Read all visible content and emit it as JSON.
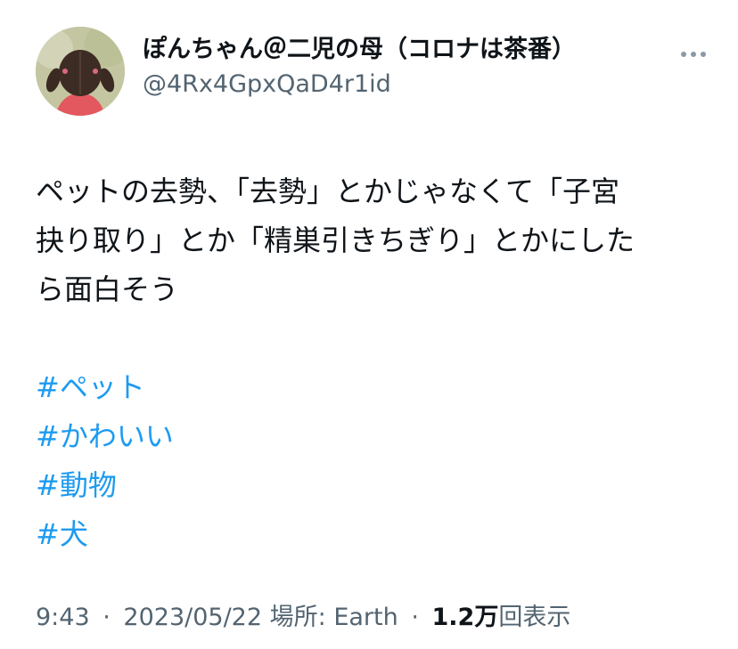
{
  "author": {
    "display_name": "ぽんちゃん＠二児の母（コロナは茶番）",
    "handle": "@4Rx4GpxQaD4r1id"
  },
  "tweet": {
    "lines": [
      "ペットの去勢、「去勢」とかじゃなくて「子宮",
      "抉り取り」とか「精巣引きちぎり」とかにした",
      "ら面白そう"
    ],
    "hashtags": [
      "#ペット",
      "#かわいい",
      "#動物",
      "#犬"
    ]
  },
  "meta": {
    "time": "9:43",
    "separator": "·",
    "date": "2023/05/22",
    "location_label": "場所: Earth",
    "views_count": "1.2万",
    "views_label": "回表示"
  },
  "icons": {
    "more": "more-horizontal-icon",
    "avatar": "avatar-photo"
  },
  "colors": {
    "text": "#0f1419",
    "secondary": "#536471",
    "hashtag": "#1d9bf0"
  }
}
